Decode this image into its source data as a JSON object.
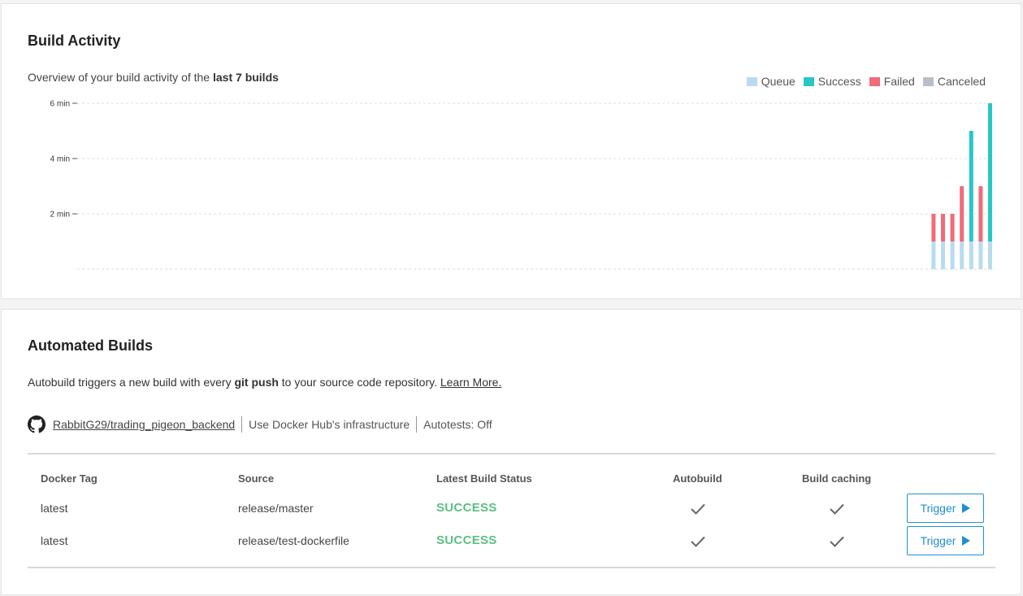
{
  "activity": {
    "title": "Build Activity",
    "subtitle_prefix": "Overview of your build activity of the ",
    "subtitle_bold": "last 7 builds",
    "legend": [
      {
        "label": "Queue",
        "color": "#b7dced"
      },
      {
        "label": "Success",
        "color": "#26c7c4"
      },
      {
        "label": "Failed",
        "color": "#f16b78"
      },
      {
        "label": "Canceled",
        "color": "#b9bfc7"
      }
    ]
  },
  "chart_data": {
    "type": "bar",
    "stacked": true,
    "yunit": "min",
    "ylim": [
      0,
      6
    ],
    "yticks": [
      {
        "value": 2,
        "label": "2 min"
      },
      {
        "value": 4,
        "label": "4 min"
      },
      {
        "value": 6,
        "label": "6 min"
      }
    ],
    "grid": true,
    "legend_position": "top-right",
    "series": [
      {
        "name": "Queue",
        "color": "#b7dced",
        "values": [
          1,
          1,
          1,
          1,
          1,
          1,
          1
        ]
      },
      {
        "name": "Success",
        "color": "#26c7c4",
        "values": [
          0,
          0,
          0,
          0,
          4,
          0,
          5
        ]
      },
      {
        "name": "Failed",
        "color": "#f16b78",
        "values": [
          1,
          1,
          1,
          2,
          0,
          2,
          0
        ]
      },
      {
        "name": "Canceled",
        "color": "#b9bfc7",
        "values": [
          0,
          0,
          0,
          0,
          0,
          0,
          0
        ]
      }
    ]
  },
  "builds": {
    "title": "Automated Builds",
    "intro_prefix": "Autobuild triggers a new build with every ",
    "intro_bold": "git push",
    "intro_suffix": " to your source code repository. ",
    "learn_more": "Learn More.",
    "repo": "RabbitG29/trading_pigeon_backend",
    "infrastructure": "Use Docker Hub's infrastructure",
    "autotests": "Autotests: Off",
    "columns": [
      "Docker Tag",
      "Source",
      "Latest Build Status",
      "Autobuild",
      "Build caching"
    ],
    "rows": [
      {
        "tag": "latest",
        "source": "release/master",
        "status": "SUCCESS",
        "trigger": "Trigger"
      },
      {
        "tag": "latest",
        "source": "release/test-dockerfile",
        "status": "SUCCESS",
        "trigger": "Trigger"
      }
    ]
  },
  "colors": {
    "success_text": "#5cbf84",
    "link_blue": "#1e8fd5"
  }
}
